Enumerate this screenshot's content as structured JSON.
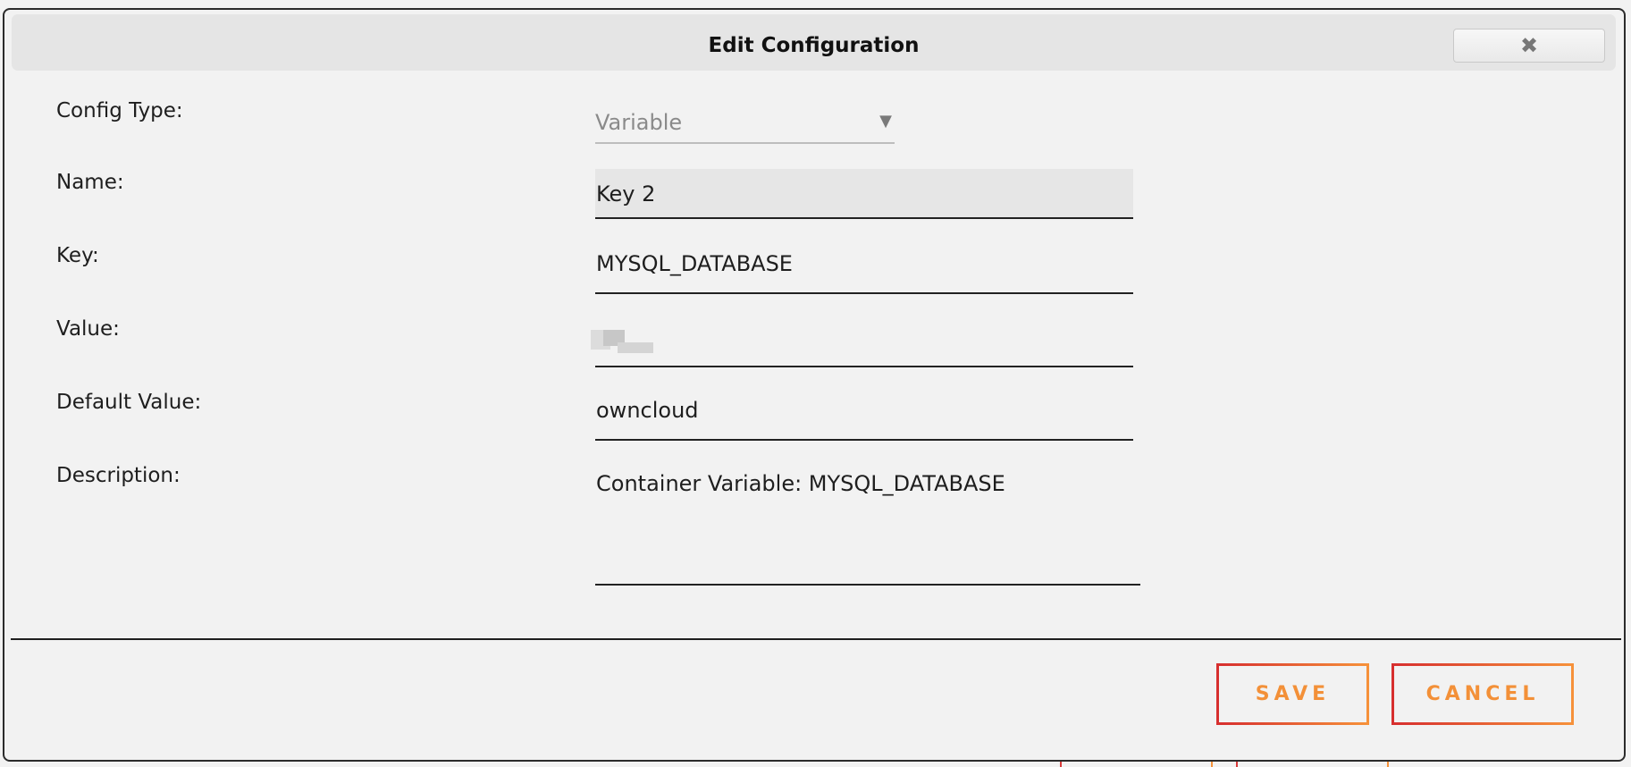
{
  "dialog": {
    "title": "Edit Configuration",
    "close_icon": "close-icon",
    "close_glyph": "✖"
  },
  "form": {
    "config_type": {
      "label": "Config Type:",
      "value": "Variable",
      "arrow_icon": "chevron-down-icon",
      "arrow_glyph": "▼"
    },
    "name": {
      "label": "Name:",
      "value": "Key 2"
    },
    "key": {
      "label": "Key:",
      "value": "MYSQL_DATABASE"
    },
    "value": {
      "label": "Value:",
      "value": ""
    },
    "default_value": {
      "label": "Default Value:",
      "value": "owncloud"
    },
    "description": {
      "label": "Description:",
      "value": "Container Variable: MYSQL_DATABASE"
    }
  },
  "actions": {
    "save_label": "SAVE",
    "cancel_label": "CANCEL"
  },
  "colors": {
    "accent_gradient_start": "#d72f2f",
    "accent_gradient_end": "#f6913a",
    "button_text": "#f39038",
    "dialog_bg": "#f2f2f2",
    "titlebar_bg": "#e5e5e5"
  }
}
